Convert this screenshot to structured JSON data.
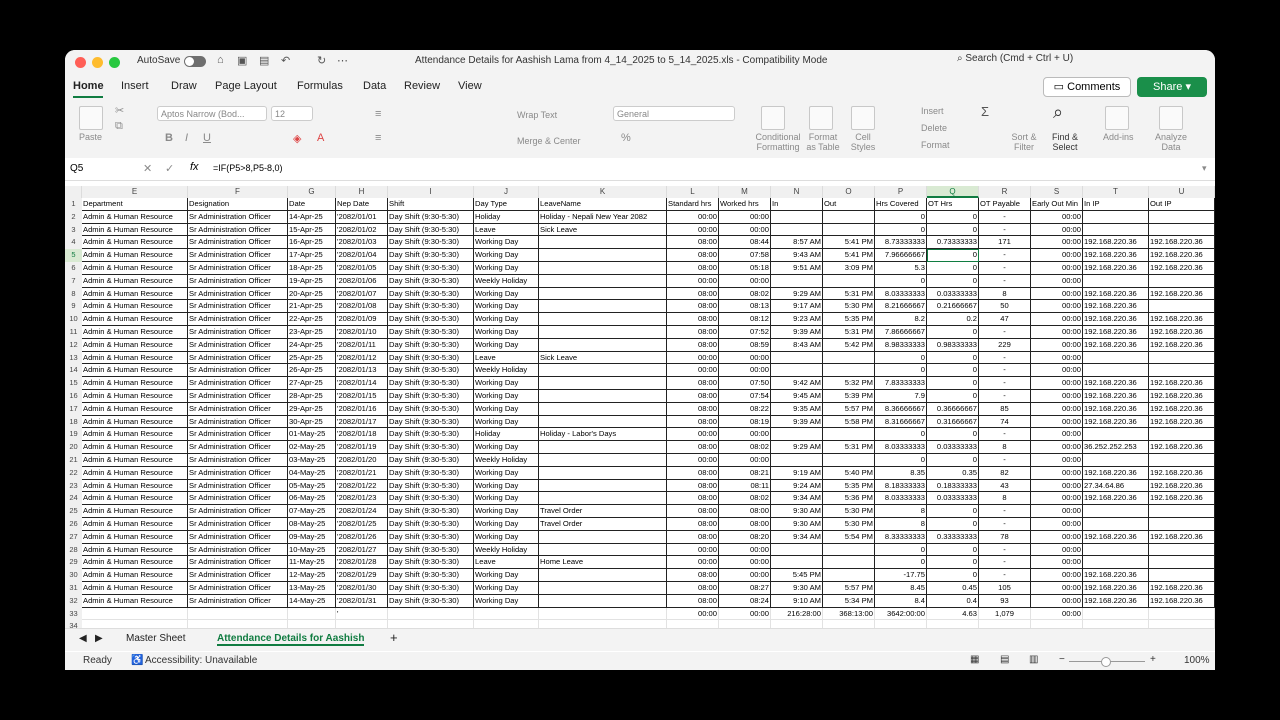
{
  "window": {
    "autosave_label": "AutoSave",
    "title": "Attendance Details  for Aashish Lama from 4_14_2025 to 5_14_2025.xls  -  Compatibility Mode",
    "search_placeholder": "Search (Cmd + Ctrl + U)"
  },
  "menu": {
    "tabs": [
      "Home",
      "Insert",
      "Draw",
      "Page Layout",
      "Formulas",
      "Data",
      "Review",
      "View"
    ],
    "comments_label": "Comments",
    "share_label": "Share"
  },
  "ribbon": {
    "paste_label": "Paste",
    "font_name": "Aptos Narrow (Bod...",
    "font_size": "12",
    "wrap_text": "Wrap Text",
    "merge_center": "Merge & Center",
    "number_format": "General",
    "conditional_formatting": "Conditional Formatting",
    "format_as_table": "Format as Table",
    "cell_styles": "Cell Styles",
    "insert": "Insert",
    "delete": "Delete",
    "format": "Format",
    "sort_filter": "Sort & Filter",
    "find_select": "Find & Select",
    "addins": "Add-ins",
    "analyze_data": "Analyze Data"
  },
  "formula_bar": {
    "name_box": "Q5",
    "fx": "fx",
    "formula": "=IF(P5>8,P5-8,0)"
  },
  "columns": [
    "E",
    "F",
    "G",
    "H",
    "I",
    "J",
    "K",
    "L",
    "M",
    "N",
    "O",
    "P",
    "Q",
    "R",
    "S",
    "T",
    "U"
  ],
  "header_row": [
    "Department",
    "Designation",
    "Date",
    "Nep Date",
    "Shift",
    "Day Type",
    "LeaveName",
    "Standard hrs",
    "Worked hrs",
    "In",
    "Out",
    "Hrs Covered",
    "OT Hrs",
    "OT Payable",
    "Early Out Min",
    "In IP",
    "Out IP"
  ],
  "rows": [
    [
      "Admin & Human Resource",
      "Sr Administration Officer",
      "14-Apr-25",
      "'2082/01/01",
      "Day Shift (9:30-5:30)",
      "Holiday",
      "Holiday - Nepali New Year 2082",
      "00:00",
      "00:00",
      "",
      "",
      "0",
      "0",
      "-",
      "00:00",
      "",
      ""
    ],
    [
      "Admin & Human Resource",
      "Sr Administration Officer",
      "15-Apr-25",
      "'2082/01/02",
      "Day Shift (9:30-5:30)",
      "Leave",
      "Sick Leave",
      "00:00",
      "00:00",
      "",
      "",
      "0",
      "0",
      "-",
      "00:00",
      "",
      ""
    ],
    [
      "Admin & Human Resource",
      "Sr Administration Officer",
      "16-Apr-25",
      "'2082/01/03",
      "Day Shift (9:30-5:30)",
      "Working Day",
      "",
      "08:00",
      "08:44",
      "8:57 AM",
      "5:41 PM",
      "8.73333333",
      "0.73333333",
      "171",
      "00:00",
      "192.168.220.36",
      "192.168.220.36"
    ],
    [
      "Admin & Human Resource",
      "Sr Administration Officer",
      "17-Apr-25",
      "'2082/01/04",
      "Day Shift (9:30-5:30)",
      "Working Day",
      "",
      "08:00",
      "07:58",
      "9:43 AM",
      "5:41 PM",
      "7.96666667",
      "0",
      "-",
      "00:00",
      "192.168.220.36",
      "192.168.220.36"
    ],
    [
      "Admin & Human Resource",
      "Sr Administration Officer",
      "18-Apr-25",
      "'2082/01/05",
      "Day Shift (9:30-5:30)",
      "Working Day",
      "",
      "08:00",
      "05:18",
      "9:51 AM",
      "3:09 PM",
      "5.3",
      "0",
      "-",
      "00:00",
      "192.168.220.36",
      "192.168.220.36"
    ],
    [
      "Admin & Human Resource",
      "Sr Administration Officer",
      "19-Apr-25",
      "'2082/01/06",
      "Day Shift (9:30-5:30)",
      "Weekly Holiday",
      "",
      "00:00",
      "00:00",
      "",
      "",
      "0",
      "0",
      "-",
      "00:00",
      "",
      ""
    ],
    [
      "Admin & Human Resource",
      "Sr Administration Officer",
      "20-Apr-25",
      "'2082/01/07",
      "Day Shift (9:30-5:30)",
      "Working Day",
      "",
      "08:00",
      "08:02",
      "9:29 AM",
      "5:31 PM",
      "8.03333333",
      "0.03333333",
      "8",
      "00:00",
      "192.168.220.36",
      "192.168.220.36"
    ],
    [
      "Admin & Human Resource",
      "Sr Administration Officer",
      "21-Apr-25",
      "'2082/01/08",
      "Day Shift (9:30-5:30)",
      "Working Day",
      "",
      "08:00",
      "08:13",
      "9:17 AM",
      "5:30 PM",
      "8.21666667",
      "0.21666667",
      "50",
      "00:00",
      "192.168.220.36",
      ""
    ],
    [
      "Admin & Human Resource",
      "Sr Administration Officer",
      "22-Apr-25",
      "'2082/01/09",
      "Day Shift (9:30-5:30)",
      "Working Day",
      "",
      "08:00",
      "08:12",
      "9:23 AM",
      "5:35 PM",
      "8.2",
      "0.2",
      "47",
      "00:00",
      "192.168.220.36",
      "192.168.220.36"
    ],
    [
      "Admin & Human Resource",
      "Sr Administration Officer",
      "23-Apr-25",
      "'2082/01/10",
      "Day Shift (9:30-5:30)",
      "Working Day",
      "",
      "08:00",
      "07:52",
      "9:39 AM",
      "5:31 PM",
      "7.86666667",
      "0",
      "-",
      "00:00",
      "192.168.220.36",
      "192.168.220.36"
    ],
    [
      "Admin & Human Resource",
      "Sr Administration Officer",
      "24-Apr-25",
      "'2082/01/11",
      "Day Shift (9:30-5:30)",
      "Working Day",
      "",
      "08:00",
      "08:59",
      "8:43 AM",
      "5:42 PM",
      "8.98333333",
      "0.98333333",
      "229",
      "00:00",
      "192.168.220.36",
      "192.168.220.36"
    ],
    [
      "Admin & Human Resource",
      "Sr Administration Officer",
      "25-Apr-25",
      "'2082/01/12",
      "Day Shift (9:30-5:30)",
      "Leave",
      "Sick Leave",
      "00:00",
      "00:00",
      "",
      "",
      "0",
      "0",
      "-",
      "00:00",
      "",
      ""
    ],
    [
      "Admin & Human Resource",
      "Sr Administration Officer",
      "26-Apr-25",
      "'2082/01/13",
      "Day Shift (9:30-5:30)",
      "Weekly Holiday",
      "",
      "00:00",
      "00:00",
      "",
      "",
      "0",
      "0",
      "-",
      "00:00",
      "",
      ""
    ],
    [
      "Admin & Human Resource",
      "Sr Administration Officer",
      "27-Apr-25",
      "'2082/01/14",
      "Day Shift (9:30-5:30)",
      "Working Day",
      "",
      "08:00",
      "07:50",
      "9:42 AM",
      "5:32 PM",
      "7.83333333",
      "0",
      "-",
      "00:00",
      "192.168.220.36",
      "192.168.220.36"
    ],
    [
      "Admin & Human Resource",
      "Sr Administration Officer",
      "28-Apr-25",
      "'2082/01/15",
      "Day Shift (9:30-5:30)",
      "Working Day",
      "",
      "08:00",
      "07:54",
      "9:45 AM",
      "5:39 PM",
      "7.9",
      "0",
      "-",
      "00:00",
      "192.168.220.36",
      "192.168.220.36"
    ],
    [
      "Admin & Human Resource",
      "Sr Administration Officer",
      "29-Apr-25",
      "'2082/01/16",
      "Day Shift (9:30-5:30)",
      "Working Day",
      "",
      "08:00",
      "08:22",
      "9:35 AM",
      "5:57 PM",
      "8.36666667",
      "0.36666667",
      "85",
      "00:00",
      "192.168.220.36",
      "192.168.220.36"
    ],
    [
      "Admin & Human Resource",
      "Sr Administration Officer",
      "30-Apr-25",
      "'2082/01/17",
      "Day Shift (9:30-5:30)",
      "Working Day",
      "",
      "08:00",
      "08:19",
      "9:39 AM",
      "5:58 PM",
      "8.31666667",
      "0.31666667",
      "74",
      "00:00",
      "192.168.220.36",
      "192.168.220.36"
    ],
    [
      "Admin & Human Resource",
      "Sr Administration Officer",
      "01-May-25",
      "'2082/01/18",
      "Day Shift (9:30-5:30)",
      "Holiday",
      "Holiday - Labor's Days",
      "00:00",
      "00:00",
      "",
      "",
      "0",
      "0",
      "-",
      "00:00",
      "",
      ""
    ],
    [
      "Admin & Human Resource",
      "Sr Administration Officer",
      "02-May-25",
      "'2082/01/19",
      "Day Shift (9:30-5:30)",
      "Working Day",
      "",
      "08:00",
      "08:02",
      "9:29 AM",
      "5:31 PM",
      "8.03333333",
      "0.03333333",
      "8",
      "00:00",
      "36.252.252.253",
      "192.168.220.36"
    ],
    [
      "Admin & Human Resource",
      "Sr Administration Officer",
      "03-May-25",
      "'2082/01/20",
      "Day Shift (9:30-5:30)",
      "Weekly Holiday",
      "",
      "00:00",
      "00:00",
      "",
      "",
      "0",
      "0",
      "-",
      "00:00",
      "",
      ""
    ],
    [
      "Admin & Human Resource",
      "Sr Administration Officer",
      "04-May-25",
      "'2082/01/21",
      "Day Shift (9:30-5:30)",
      "Working Day",
      "",
      "08:00",
      "08:21",
      "9:19 AM",
      "5:40 PM",
      "8.35",
      "0.35",
      "82",
      "00:00",
      "192.168.220.36",
      "192.168.220.36"
    ],
    [
      "Admin & Human Resource",
      "Sr Administration Officer",
      "05-May-25",
      "'2082/01/22",
      "Day Shift (9:30-5:30)",
      "Working Day",
      "",
      "08:00",
      "08:11",
      "9:24 AM",
      "5:35 PM",
      "8.18333333",
      "0.18333333",
      "43",
      "00:00",
      "27.34.64.86",
      "192.168.220.36"
    ],
    [
      "Admin & Human Resource",
      "Sr Administration Officer",
      "06-May-25",
      "'2082/01/23",
      "Day Shift (9:30-5:30)",
      "Working Day",
      "",
      "08:00",
      "08:02",
      "9:34 AM",
      "5:36 PM",
      "8.03333333",
      "0.03333333",
      "8",
      "00:00",
      "192.168.220.36",
      "192.168.220.36"
    ],
    [
      "Admin & Human Resource",
      "Sr Administration Officer",
      "07-May-25",
      "'2082/01/24",
      "Day Shift (9:30-5:30)",
      "Working Day",
      "Travel Order",
      "08:00",
      "08:00",
      "9:30 AM",
      "5:30 PM",
      "8",
      "0",
      "-",
      "00:00",
      "",
      ""
    ],
    [
      "Admin & Human Resource",
      "Sr Administration Officer",
      "08-May-25",
      "'2082/01/25",
      "Day Shift (9:30-5:30)",
      "Working Day",
      "Travel Order",
      "08:00",
      "08:00",
      "9:30 AM",
      "5:30 PM",
      "8",
      "0",
      "-",
      "00:00",
      "",
      ""
    ],
    [
      "Admin & Human Resource",
      "Sr Administration Officer",
      "09-May-25",
      "'2082/01/26",
      "Day Shift (9:30-5:30)",
      "Working Day",
      "",
      "08:00",
      "08:20",
      "9:34 AM",
      "5:54 PM",
      "8.33333333",
      "0.33333333",
      "78",
      "00:00",
      "192.168.220.36",
      "192.168.220.36"
    ],
    [
      "Admin & Human Resource",
      "Sr Administration Officer",
      "10-May-25",
      "'2082/01/27",
      "Day Shift (9:30-5:30)",
      "Weekly Holiday",
      "",
      "00:00",
      "00:00",
      "",
      "",
      "0",
      "0",
      "-",
      "00:00",
      "",
      ""
    ],
    [
      "Admin & Human Resource",
      "Sr Administration Officer",
      "11-May-25",
      "'2082/01/28",
      "Day Shift (9:30-5:30)",
      "Leave",
      "Home Leave",
      "00:00",
      "00:00",
      "",
      "",
      "0",
      "0",
      "-",
      "00:00",
      "",
      ""
    ],
    [
      "Admin & Human Resource",
      "Sr Administration Officer",
      "12-May-25",
      "'2082/01/29",
      "Day Shift (9:30-5:30)",
      "Working Day",
      "",
      "08:00",
      "00:00",
      "5:45 PM",
      "",
      "-17.75",
      "0",
      "-",
      "00:00",
      "192.168.220.36",
      ""
    ],
    [
      "Admin & Human Resource",
      "Sr Administration Officer",
      "13-May-25",
      "'2082/01/30",
      "Day Shift (9:30-5:30)",
      "Working Day",
      "",
      "08:00",
      "08:27",
      "9:30 AM",
      "5:57 PM",
      "8.45",
      "0.45",
      "105",
      "00:00",
      "192.168.220.36",
      "192.168.220.36"
    ],
    [
      "Admin & Human Resource",
      "Sr Administration Officer",
      "14-May-25",
      "'2082/01/31",
      "Day Shift (9:30-5:30)",
      "Working Day",
      "",
      "08:00",
      "08:24",
      "9:10 AM",
      "5:34 PM",
      "8.4",
      "0.4",
      "93",
      "00:00",
      "192.168.220.36",
      "192.168.220.36"
    ],
    [
      "",
      "",
      "",
      "'",
      "",
      "",
      "",
      "00:00",
      "00:00",
      "216:28:00",
      "368:13:00",
      "3642:00:00",
      "4.63",
      "1,079",
      "00:00",
      "",
      ""
    ],
    [
      "",
      "",
      "",
      "",
      "",
      "",
      "",
      "",
      "",
      "",
      "",
      "",
      "",
      "",
      "",
      "",
      ""
    ]
  ],
  "sheets": {
    "tabs": [
      "Master Sheet",
      "Attendance Details  for Aashish"
    ],
    "active": "Attendance Details  for Aashish"
  },
  "status": {
    "ready": "Ready",
    "accessibility": "Accessibility: Unavailable",
    "zoom": "100%"
  },
  "colors": {
    "accent": "#107c41",
    "share": "#1a8f4a"
  }
}
